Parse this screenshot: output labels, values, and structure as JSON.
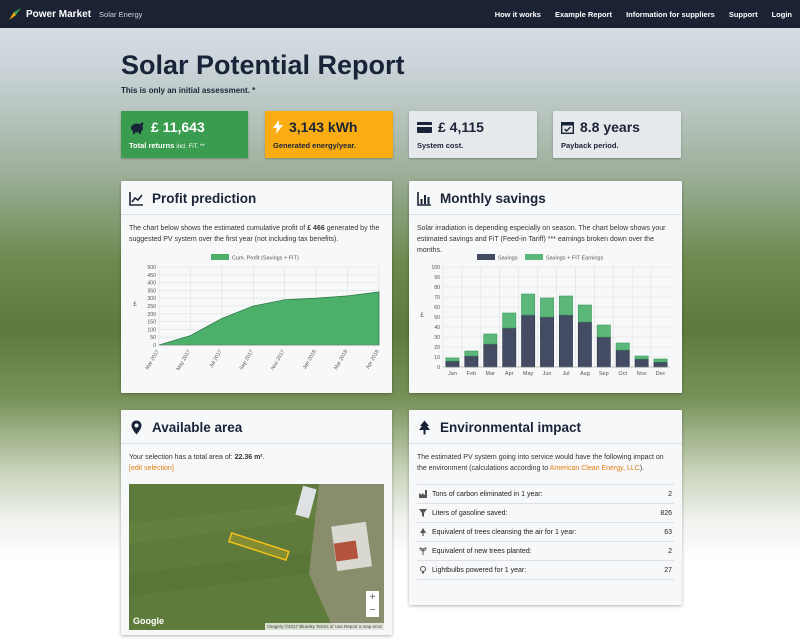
{
  "nav": {
    "brand": "Power Market",
    "brand_sub": "Solar Energy",
    "links": [
      "How it works",
      "Example Report",
      "Information for suppliers",
      "Support",
      "Login"
    ]
  },
  "header": {
    "title": "Solar Potential Report",
    "subtitle": "This is only an initial assessment. *"
  },
  "stats": [
    {
      "value": "£ 11,643",
      "label": "Total returns",
      "note": "incl. FiT. **",
      "icon": "piggy-bank-icon",
      "color": "#3a9c4e"
    },
    {
      "value": "3,143 kWh",
      "label": "Generated energy/year.",
      "icon": "lightning-icon",
      "color": "#f9ad12"
    },
    {
      "value": "£ 4,115",
      "label": "System cost.",
      "icon": "credit-card-icon",
      "color": "#e6e9ec"
    },
    {
      "value": "8.8 years",
      "label": "Payback period.",
      "icon": "calendar-check-icon",
      "color": "#e6e9ec"
    }
  ],
  "profit": {
    "title": "Profit prediction",
    "text_before": "The chart below shows the estimated cumulative profit of",
    "amount": "£ 466",
    "text_after": "generated by the suggested PV system over the first year (not including tax benefits)."
  },
  "monthly": {
    "title": "Monthly savings",
    "text": "Solar irradiation is depending especially on season. The chart below shows your estimated savings and FiT (Feed-in Tariff) *** earnings broken down over the months."
  },
  "area": {
    "title": "Available area",
    "text_before": "Your selection has a total area of:",
    "area_value": "22.36 m²",
    "text_after": ".",
    "edit_link": "edit selection",
    "map_logo": "Google",
    "map_footer": "Imagery ©2017 Bluesky   Terms of Use   Report a map error",
    "zoom_in": "+",
    "zoom_out": "−"
  },
  "env": {
    "title": "Environmental impact",
    "text_before": "The estimated PV system going into service would have the following impact on the environment (calculations according to",
    "link": "American Clean Energy, LLC",
    "text_after": ").",
    "rows": [
      {
        "label": "Tons of carbon eliminated in 1 year:",
        "value": "2",
        "icon": "industry-icon"
      },
      {
        "label": "Liters of gasoline saved:",
        "value": "826",
        "icon": "filter-icon"
      },
      {
        "label": "Equivalent of trees cleansing the air for 1 year:",
        "value": "63",
        "icon": "tree-icon"
      },
      {
        "label": "Equivalent of new trees planted:",
        "value": "2",
        "icon": "sprout-icon"
      },
      {
        "label": "Lightbulbs powered for 1 year:",
        "value": "27",
        "icon": "lightbulb-icon"
      }
    ]
  },
  "chart_data": [
    {
      "type": "area",
      "legend": "Cum. Profit (Savings + FIT)",
      "ylabel": "£",
      "ylim": [
        0,
        500
      ],
      "yticks": [
        0,
        50,
        100,
        150,
        200,
        250,
        300,
        350,
        400,
        450,
        500
      ],
      "x": [
        "Mar 2017",
        "May 2017",
        "Jul 2017",
        "Sep 2017",
        "Nov 2017",
        "Jan 2018",
        "Mar 2018",
        "Apr 2018"
      ],
      "values": [
        0,
        60,
        170,
        250,
        290,
        300,
        315,
        340
      ],
      "color": "#4caf6a"
    },
    {
      "type": "bar",
      "stacked": true,
      "ylabel": "£",
      "ylim": [
        0,
        100
      ],
      "yticks": [
        0,
        10,
        20,
        30,
        40,
        50,
        60,
        70,
        80,
        90,
        100
      ],
      "categories": [
        "Jan",
        "Feb",
        "Mar",
        "Apr",
        "May",
        "Jun",
        "Jul",
        "Aug",
        "Sep",
        "Oct",
        "Nov",
        "Dec"
      ],
      "series": [
        {
          "name": "Savings",
          "values": [
            6,
            11,
            23,
            39,
            52,
            50,
            52,
            45,
            30,
            17,
            8,
            5
          ],
          "color": "#444c63"
        },
        {
          "name": "Savings + FIT Earnings",
          "values": [
            3,
            5,
            10,
            15,
            21,
            19,
            19,
            17,
            12,
            7,
            3,
            3
          ],
          "color": "#5cb87a"
        }
      ]
    }
  ]
}
